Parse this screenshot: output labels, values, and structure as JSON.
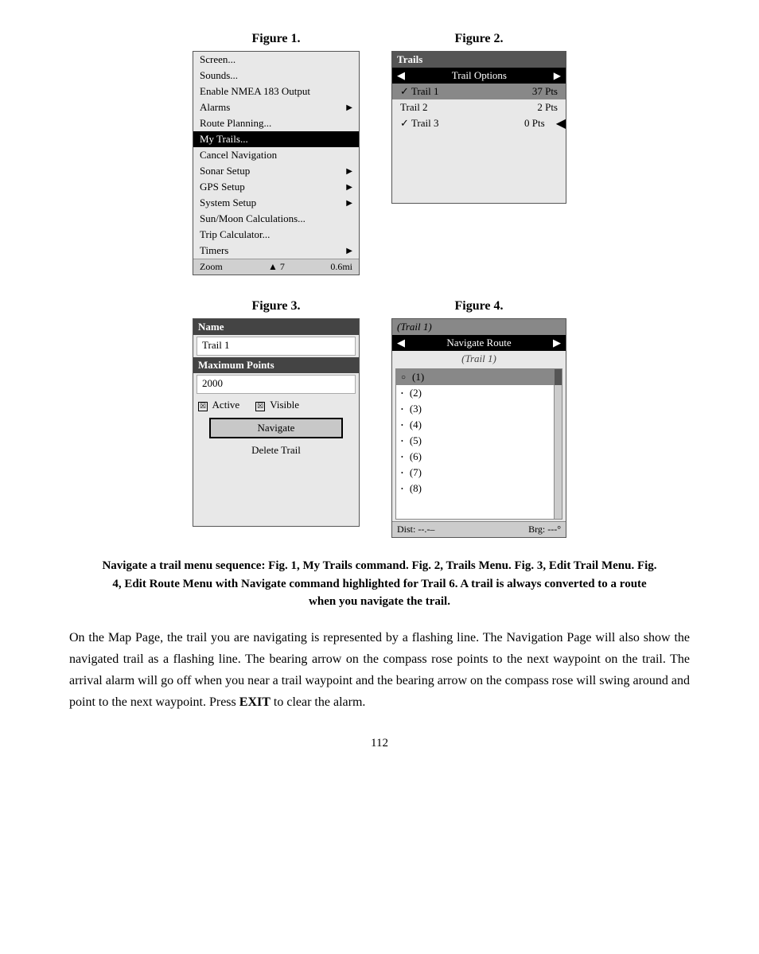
{
  "figures": {
    "fig1": {
      "label": "Figure 1.",
      "menu_items": [
        {
          "text": "Screen...",
          "arrow": false,
          "highlighted": false
        },
        {
          "text": "Sounds...",
          "arrow": false,
          "highlighted": false
        },
        {
          "text": "Enable NMEA 183 Output",
          "arrow": false,
          "highlighted": false
        },
        {
          "text": "Alarms",
          "arrow": true,
          "highlighted": false
        },
        {
          "text": "Route Planning...",
          "arrow": false,
          "highlighted": false
        },
        {
          "text": "My Trails...",
          "arrow": false,
          "highlighted": true
        },
        {
          "text": "Cancel Navigation",
          "arrow": false,
          "highlighted": false
        },
        {
          "text": "Sonar Setup",
          "arrow": true,
          "highlighted": false
        },
        {
          "text": "GPS Setup",
          "arrow": true,
          "highlighted": false
        },
        {
          "text": "System Setup",
          "arrow": true,
          "highlighted": false
        },
        {
          "text": "Sun/Moon Calculations...",
          "arrow": false,
          "highlighted": false
        },
        {
          "text": "Trip Calculator...",
          "arrow": false,
          "highlighted": false
        },
        {
          "text": "Timers",
          "arrow": true,
          "highlighted": false
        }
      ],
      "bottom_left": "Zoom",
      "bottom_nav": "▲  7",
      "bottom_right": "0.6mi"
    },
    "fig2": {
      "label": "Figure 2.",
      "header": "Trails",
      "nav_label": "Trail Options",
      "trails": [
        {
          "name": "✓ Trail 1",
          "pts": "37 Pts",
          "highlighted": true,
          "pointer": false
        },
        {
          "name": "Trail 2",
          "pts": "2 Pts",
          "highlighted": false,
          "pointer": false
        },
        {
          "name": "✓ Trail 3",
          "pts": "0 Pts",
          "highlighted": false,
          "pointer": true
        }
      ]
    },
    "fig3": {
      "label": "Figure 3.",
      "name_label": "Name",
      "name_value": "Trail 1",
      "max_pts_label": "Maximum Points",
      "max_pts_value": "2000",
      "active_label": "Active",
      "visible_label": "Visible",
      "navigate_btn": "Navigate",
      "delete_btn": "Delete Trail"
    },
    "fig4": {
      "label": "Figure 4.",
      "header": "(Trail 1)",
      "nav_label": "Navigate Route",
      "subtitle": "(Trail 1)",
      "items": [
        {
          "label": "(1)",
          "selected": true,
          "open_circle": true
        },
        {
          "label": "(2)",
          "selected": false,
          "open_circle": false
        },
        {
          "label": "(3)",
          "selected": false,
          "open_circle": false
        },
        {
          "label": "(4)",
          "selected": false,
          "open_circle": false
        },
        {
          "label": "(5)",
          "selected": false,
          "open_circle": false
        },
        {
          "label": "(6)",
          "selected": false,
          "open_circle": false
        },
        {
          "label": "(7)",
          "selected": false,
          "open_circle": false
        },
        {
          "label": "(8)",
          "selected": false,
          "open_circle": false
        }
      ],
      "dist": "Dist: --.-–",
      "brg": "Brg: ---°"
    }
  },
  "caption": "Navigate a trail menu sequence: Fig. 1, My Trails command. Fig. 2, Trails Menu. Fig. 3, Edit Trail Menu. Fig. 4, Edit Route Menu with Navigate command highlighted for Trail 6. A trail is always converted to a route when you navigate the trail.",
  "body_text": "On  the  Map  Page,  the  trail  you  are  navigating  is  represented  by  a flashing line. The Navigation Page will also show the navigated trail as a flashing line. The bearing arrow on the compass rose points to the next waypoint on the trail. The arrival alarm will go off when you near a trail waypoint and the bearing arrow on the compass rose will swing around and point to the next waypoint. Press ",
  "body_exit": "EXIT",
  "body_text_end": " to clear the alarm.",
  "page_number": "112"
}
